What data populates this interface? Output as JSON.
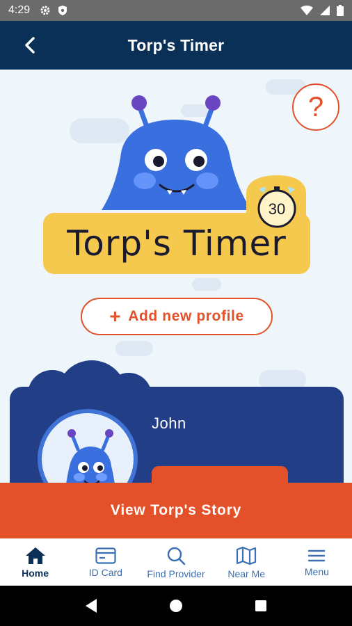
{
  "status_bar": {
    "time": "4:29"
  },
  "app_bar": {
    "title": "Torp's Timer"
  },
  "hero": {
    "logo_text": "Torp's Timer",
    "timer_value": "30"
  },
  "help": {
    "label": "?"
  },
  "add_profile": {
    "plus": "+",
    "label": "Add new profile"
  },
  "profile": {
    "name": "John"
  },
  "story_button": {
    "label": "View Torp's Story"
  },
  "bottom_nav": {
    "items": [
      {
        "label": "Home",
        "icon": "home-icon",
        "active": true
      },
      {
        "label": "ID Card",
        "icon": "id-card-icon",
        "active": false
      },
      {
        "label": "Find Provider",
        "icon": "search-icon",
        "active": false
      },
      {
        "label": "Near Me",
        "icon": "map-icon",
        "active": false
      },
      {
        "label": "Menu",
        "icon": "menu-icon",
        "active": false
      }
    ]
  },
  "colors": {
    "primary": "#0b3057",
    "accent": "#e2512a",
    "card": "#213e87",
    "logo": "#f4c94e",
    "monster": "#3a6fe0"
  }
}
